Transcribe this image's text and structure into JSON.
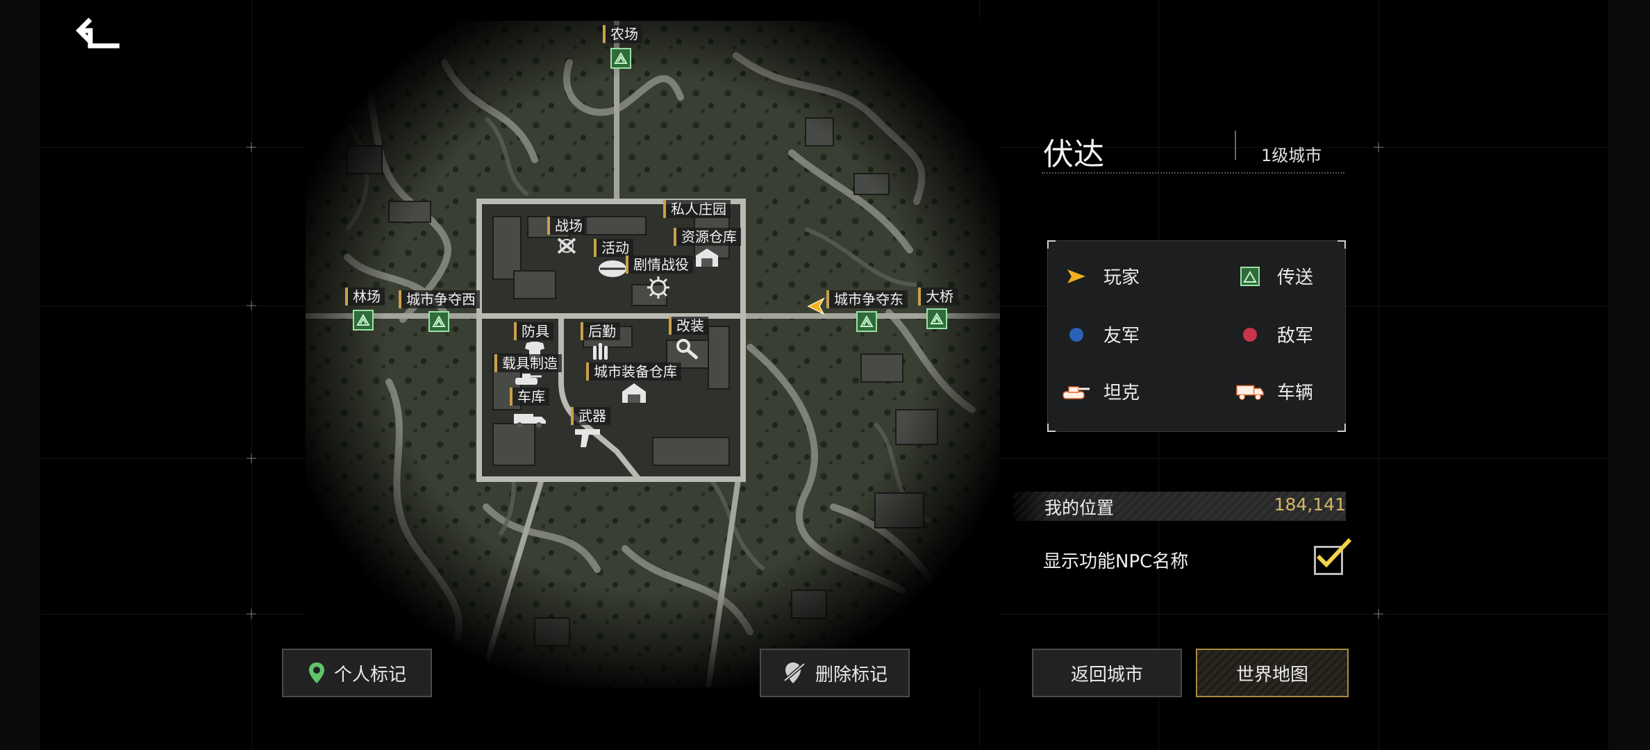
{
  "city": {
    "name": "伏达",
    "level": "1级城市"
  },
  "map": {
    "pois": [
      {
        "id": "farm",
        "label": "农场",
        "kind": "teleport"
      },
      {
        "id": "manor",
        "label": "私人庄园",
        "kind": "label"
      },
      {
        "id": "battlefield",
        "label": "战场",
        "kind": "icon"
      },
      {
        "id": "resource",
        "label": "资源仓库",
        "kind": "icon"
      },
      {
        "id": "activity",
        "label": "活动",
        "kind": "icon"
      },
      {
        "id": "story",
        "label": "剧情战役",
        "kind": "icon"
      },
      {
        "id": "forest",
        "label": "林场",
        "kind": "teleport"
      },
      {
        "id": "west",
        "label": "城市争夺西",
        "kind": "teleport"
      },
      {
        "id": "east",
        "label": "城市争夺东",
        "kind": "teleport"
      },
      {
        "id": "bridge",
        "label": "大桥",
        "kind": "teleport"
      },
      {
        "id": "armor",
        "label": "防具",
        "kind": "icon"
      },
      {
        "id": "logistics",
        "label": "后勤",
        "kind": "icon"
      },
      {
        "id": "modify",
        "label": "改装",
        "kind": "icon"
      },
      {
        "id": "vehicle_make",
        "label": "载具制造",
        "kind": "icon"
      },
      {
        "id": "equip",
        "label": "城市装备仓库",
        "kind": "icon"
      },
      {
        "id": "garage",
        "label": "车库",
        "kind": "icon"
      },
      {
        "id": "weapon",
        "label": "武器",
        "kind": "icon"
      }
    ]
  },
  "legend": {
    "player": "玩家",
    "teleport": "传送",
    "ally": "友军",
    "enemy": "敌军",
    "tank": "坦克",
    "vehicle": "车辆"
  },
  "my_position": {
    "label": "我的位置",
    "value": "184,141"
  },
  "npc_toggle": {
    "label": "显示功能NPC名称",
    "checked": true
  },
  "buttons": {
    "personal_mark": "个人标记",
    "delete_mark": "删除标记",
    "return_city": "返回城市",
    "world_map": "世界地图"
  },
  "colors": {
    "accent_gold": "#c9a04a",
    "teleport_green": "#2f6b3b",
    "ally_blue": "#2a62b8",
    "enemy_red": "#c8344a",
    "player_yellow": "#f2b01e"
  }
}
